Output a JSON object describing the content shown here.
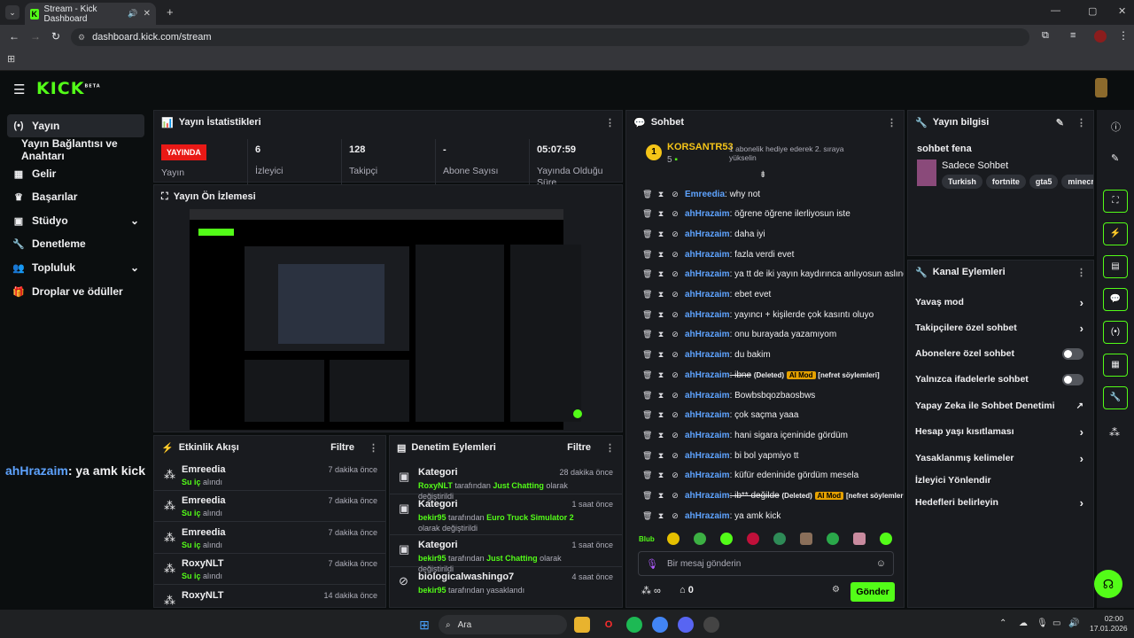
{
  "browser": {
    "tab_title": "Stream - Kick Dashboard",
    "url": "dashboard.kick.com/stream"
  },
  "sidebar": {
    "items": [
      {
        "label": "Yayın",
        "icon": "broadcast-icon"
      },
      {
        "label": "Yayın Bağlantısı ve Anahtarı",
        "icon": ""
      },
      {
        "label": "Gelir",
        "icon": "chart-icon"
      },
      {
        "label": "Başarılar",
        "icon": "trophy-icon"
      },
      {
        "label": "Stüdyo",
        "icon": "studio-icon"
      },
      {
        "label": "Denetleme",
        "icon": "wrench-icon"
      },
      {
        "label": "Topluluk",
        "icon": "people-icon"
      },
      {
        "label": "Droplar ve ödüller",
        "icon": "gift-icon"
      }
    ]
  },
  "overlay_chat": {
    "user": "ahHrazaim",
    "text": ": ya amk kick"
  },
  "stats": {
    "title": "Yayın İstatistikleri",
    "live": "YAYINDA",
    "live_label": "Yayın",
    "viewers": "6",
    "viewers_label": "İzleyici",
    "followers": "128",
    "followers_label": "Takipçi",
    "subs": "-",
    "subs_label": "Abone Sayısı",
    "uptime": "05:07:59",
    "uptime_label": "Yayında Olduğu Süre"
  },
  "preview": {
    "title": "Yayın Ön İzlemesi"
  },
  "activity": {
    "title": "Etkinlik Akışı",
    "filter": "Filtre",
    "rows": [
      {
        "name": "Emreedia",
        "sub": "Su iç",
        "sub2": "alındı",
        "time": "7 dakika önce"
      },
      {
        "name": "Emreedia",
        "sub": "Su iç",
        "sub2": "alındı",
        "time": "7 dakika önce"
      },
      {
        "name": "Emreedia",
        "sub": "Su iç",
        "sub2": "alındı",
        "time": "7 dakika önce"
      },
      {
        "name": "RoxyNLT",
        "sub": "Su iç",
        "sub2": "alındı",
        "time": "7 dakika önce"
      },
      {
        "name": "RoxyNLT",
        "sub": "",
        "sub2": "",
        "time": "14 dakika önce"
      }
    ]
  },
  "moderation": {
    "title": "Denetim Eylemleri",
    "filter": "Filtre",
    "rows": [
      {
        "name": "Kategori",
        "user": "RoxyNLT",
        "mid": "tarafından",
        "value": "Just Chatting",
        "end": "olarak değiştirildi",
        "time": "28 dakika önce"
      },
      {
        "name": "Kategori",
        "user": "bekir95",
        "mid": "tarafından",
        "value": "Euro Truck Simulator 2",
        "end": "olarak değiştirildi",
        "time": "1 saat önce"
      },
      {
        "name": "Kategori",
        "user": "bekir95",
        "mid": "tarafından",
        "value": "Just Chatting",
        "end": "olarak değiştirildi",
        "time": "1 saat önce"
      },
      {
        "name": "biologicalwashingo7",
        "user": "bekir95",
        "mid": "tarafından yasaklandı",
        "value": "",
        "end": "",
        "time": "4 saat önce"
      }
    ]
  },
  "chat": {
    "title": "Sohbet",
    "pinned_user": "KORSANTR53",
    "pinned_rank": "1",
    "pinned_count": "5",
    "pinned_note": "1 abonelik hediye ederek 2. sıraya yükselin",
    "messages": [
      {
        "user": "Emreedia",
        "text": ": why not"
      },
      {
        "user": "ahHrazaim",
        "text": ": öğrene öğrene ilerliyosun iste"
      },
      {
        "user": "ahHrazaim",
        "text": ": daha iyi"
      },
      {
        "user": "ahHrazaim",
        "text": ": fazla verdi evet"
      },
      {
        "user": "ahHrazaim",
        "text": ": ya tt de iki yayın kaydırınca anlıyosun aslında"
      },
      {
        "user": "ahHrazaim",
        "text": ": ebet evet"
      },
      {
        "user": "ahHrazaim",
        "text": ": yayıncı + kişilerde çok kasıntı oluyo"
      },
      {
        "user": "ahHrazaim",
        "text": ": onu burayada yazamıyom"
      },
      {
        "user": "ahHrazaim",
        "text": ": du bakim"
      },
      {
        "user": "ahHrazaim",
        "text": ": ibne",
        "deleted": "(Deleted)",
        "ai": "AI Mod",
        "reason": "[nefret söylemleri]"
      },
      {
        "user": "ahHrazaim",
        "text": ": Bowbsbqozbaosbws"
      },
      {
        "user": "ahHrazaim",
        "text": ": çok saçma yaaa"
      },
      {
        "user": "ahHrazaim",
        "text": ": hani sigara içeninide gördüm"
      },
      {
        "user": "ahHrazaim",
        "text": ": bi bol yapmiyo tt"
      },
      {
        "user": "ahHrazaim",
        "text": ": küfür edeninide gördüm mesela"
      },
      {
        "user": "ahHrazaim",
        "text": ": ib** değilde",
        "deleted": "(Deleted)",
        "ai": "AI Mod",
        "reason": "[nefret söylemleri]"
      },
      {
        "user": "ahHrazaim",
        "text": ": ya amk kick"
      }
    ],
    "input_placeholder": "Bir mesaj gönderin",
    "points": "0",
    "send": "Gönder"
  },
  "info": {
    "title": "Yayın bilgisi",
    "stream_title": "sohbet fena",
    "category": "Sadece Sohbet",
    "tags": [
      "Turkish",
      "fortnite",
      "gta5",
      "minecraft"
    ]
  },
  "channel_actions": {
    "title": "Kanal Eylemleri",
    "items": [
      {
        "label": "Yavaş mod",
        "type": "arrow"
      },
      {
        "label": "Takipçilere özel sohbet",
        "type": "arrow"
      },
      {
        "label": "Abonelere özel sohbet",
        "type": "toggle"
      },
      {
        "label": "Yalnızca ifadelerle sohbet",
        "type": "toggle"
      },
      {
        "label": "Yapay Zeka ile Sohbet Denetimi",
        "type": "external"
      },
      {
        "label": "Hesap yaşı kısıtlaması",
        "type": "arrow"
      },
      {
        "label": "Yasaklanmış kelimeler",
        "type": "arrow"
      },
      {
        "label": "İzleyici Yönlendir",
        "type": "none"
      },
      {
        "label": "Hedefleri belirleyin",
        "type": "arrow"
      }
    ]
  },
  "taskbar": {
    "search": "Ara",
    "time": "02:00",
    "date": "17.01.2026"
  },
  "colors": {
    "accent": "#53fc18",
    "live": "#e91916",
    "username": "#5ea3ff"
  }
}
